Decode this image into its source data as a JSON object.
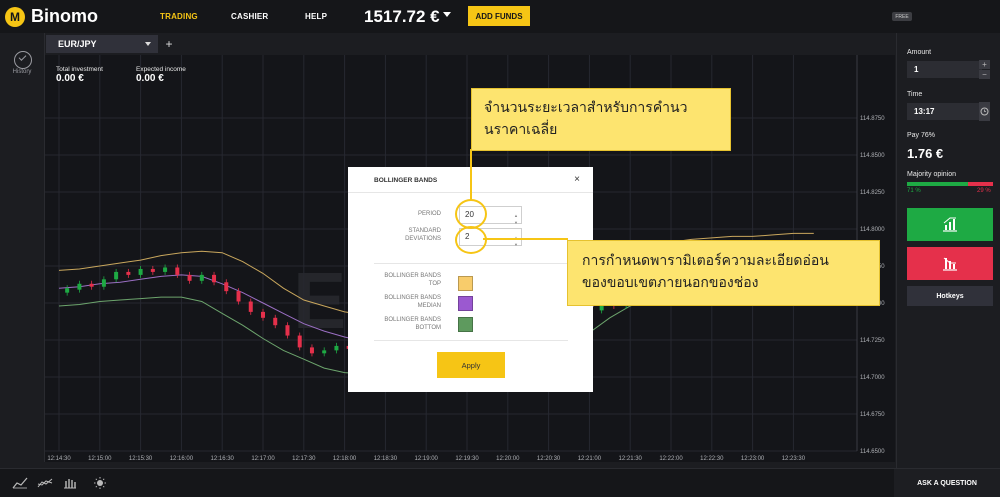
{
  "header": {
    "logo_text": "Binomo",
    "logo_mark": "M",
    "nav": [
      "TRADING",
      "CASHIER",
      "HELP"
    ],
    "balance": "1517.72 €",
    "add_funds_label": "ADD FUNDS",
    "free_badge": "FREE"
  },
  "left_sidebar": {
    "history_label": "History"
  },
  "asset": {
    "name": "EUR/JPY",
    "add_label": "+"
  },
  "stats": {
    "total_investment_label": "Total investment",
    "total_investment_value": "0.00 €",
    "expected_income_label": "Expected income",
    "expected_income_value": "0.00 €"
  },
  "chart_data": {
    "type": "line",
    "title": "",
    "y_ticks": [
      "114.8750",
      "114.8500",
      "114.8250",
      "114.8000",
      "114.7750",
      "114.7500",
      "114.7250",
      "114.7000",
      "114.6750",
      "114.6500"
    ],
    "x_ticks": [
      "12:14:30",
      "12:15:00",
      "12:15:30",
      "12:16:00",
      "12:16:30",
      "12:17:00",
      "12:17:30",
      "12:18:00",
      "12:18:30",
      "12:19:00",
      "12:19:30",
      "12:20:00",
      "12:20:30",
      "12:21:00",
      "12:21:30",
      "12:22:00",
      "12:22:30",
      "12:23:00",
      "12:23:30"
    ],
    "watermark": "EUR",
    "series": [
      {
        "color": "#c9a75d",
        "x": [
          0,
          0.5,
          1,
          1.5,
          2,
          2.5,
          3,
          3.5,
          4,
          4.5,
          5,
          5.5,
          6,
          6.5,
          7,
          7.5,
          8,
          9,
          10,
          11,
          12,
          13,
          13.5,
          14,
          14.5,
          15,
          15.5,
          16,
          16.5,
          17,
          17.5,
          18,
          18.5
        ],
        "values": [
          114.772,
          114.773,
          114.775,
          114.777,
          114.779,
          114.782,
          114.784,
          114.785,
          114.784,
          114.778,
          114.77,
          114.76,
          114.752,
          114.748,
          114.744,
          114.742,
          114.742,
          114.742,
          114.742,
          114.742,
          114.75,
          114.764,
          114.776,
          114.785,
          114.79,
          114.791,
          114.793,
          114.794,
          114.795,
          114.795,
          114.796,
          114.797,
          114.797
        ]
      },
      {
        "color": "#9b6fc4",
        "x": [
          0,
          0.5,
          1,
          1.5,
          2,
          2.5,
          3,
          3.5,
          4,
          4.5,
          5,
          5.5,
          6,
          6.5,
          7,
          7.5,
          8,
          13,
          13.5,
          14,
          14.5,
          15,
          15.5,
          16,
          16.5,
          17,
          17.5,
          18,
          18.5
        ],
        "values": [
          114.76,
          114.761,
          114.763,
          114.764,
          114.766,
          114.768,
          114.769,
          114.768,
          114.763,
          114.757,
          114.75,
          114.743,
          114.736,
          114.731,
          114.727,
          114.724,
          114.722,
          114.746,
          114.756,
          114.764,
          114.77,
          114.774,
          114.777,
          114.779,
          114.781,
          114.782,
          114.783,
          114.784,
          114.784
        ]
      },
      {
        "color": "#6da56d",
        "x": [
          0,
          0.5,
          1,
          1.5,
          2,
          2.5,
          3,
          3.5,
          4,
          4.5,
          5,
          5.5,
          6,
          6.5,
          7,
          7.5,
          8,
          13,
          13.5,
          14,
          14.5,
          15,
          15.5,
          16,
          16.5,
          17,
          17.5,
          18,
          18.5
        ],
        "values": [
          114.748,
          114.749,
          114.751,
          114.752,
          114.753,
          114.754,
          114.754,
          114.751,
          114.743,
          114.735,
          114.726,
          114.718,
          114.712,
          114.706,
          114.703,
          114.702,
          114.702,
          114.73,
          114.74,
          114.748,
          114.753,
          114.758,
          114.761,
          114.764,
          114.766,
          114.768,
          114.77,
          114.77,
          114.771
        ]
      }
    ],
    "candles": [
      {
        "x": 0.2,
        "o": 114.757,
        "c": 114.76,
        "dir": "up"
      },
      {
        "x": 0.5,
        "o": 114.759,
        "c": 114.763,
        "dir": "up"
      },
      {
        "x": 0.8,
        "o": 114.763,
        "c": 114.761,
        "dir": "down"
      },
      {
        "x": 1.1,
        "o": 114.761,
        "c": 114.766,
        "dir": "up"
      },
      {
        "x": 1.4,
        "o": 114.766,
        "c": 114.771,
        "dir": "up"
      },
      {
        "x": 1.7,
        "o": 114.771,
        "c": 114.769,
        "dir": "down"
      },
      {
        "x": 2.0,
        "o": 114.769,
        "c": 114.773,
        "dir": "up"
      },
      {
        "x": 2.3,
        "o": 114.773,
        "c": 114.771,
        "dir": "down"
      },
      {
        "x": 2.6,
        "o": 114.771,
        "c": 114.774,
        "dir": "up"
      },
      {
        "x": 2.9,
        "o": 114.774,
        "c": 114.769,
        "dir": "down"
      },
      {
        "x": 3.2,
        "o": 114.769,
        "c": 114.765,
        "dir": "down"
      },
      {
        "x": 3.5,
        "o": 114.765,
        "c": 114.769,
        "dir": "up"
      },
      {
        "x": 3.8,
        "o": 114.769,
        "c": 114.764,
        "dir": "down"
      },
      {
        "x": 4.1,
        "o": 114.764,
        "c": 114.758,
        "dir": "down"
      },
      {
        "x": 4.4,
        "o": 114.758,
        "c": 114.751,
        "dir": "down"
      },
      {
        "x": 4.7,
        "o": 114.751,
        "c": 114.744,
        "dir": "down"
      },
      {
        "x": 5.0,
        "o": 114.744,
        "c": 114.74,
        "dir": "down"
      },
      {
        "x": 5.3,
        "o": 114.74,
        "c": 114.735,
        "dir": "down"
      },
      {
        "x": 5.6,
        "o": 114.735,
        "c": 114.728,
        "dir": "down"
      },
      {
        "x": 5.9,
        "o": 114.728,
        "c": 114.72,
        "dir": "down"
      },
      {
        "x": 6.2,
        "o": 114.72,
        "c": 114.716,
        "dir": "down"
      },
      {
        "x": 6.5,
        "o": 114.716,
        "c": 114.718,
        "dir": "up"
      },
      {
        "x": 6.8,
        "o": 114.718,
        "c": 114.721,
        "dir": "up"
      },
      {
        "x": 7.1,
        "o": 114.721,
        "c": 114.719,
        "dir": "down"
      },
      {
        "x": 7.4,
        "o": 114.719,
        "c": 114.722,
        "dir": "up"
      },
      {
        "x": 7.7,
        "o": 114.722,
        "c": 114.72,
        "dir": "down"
      },
      {
        "x": 8.0,
        "o": 114.72,
        "c": 114.708,
        "dir": "down"
      },
      {
        "x": 8.3,
        "o": 114.708,
        "c": 114.7,
        "dir": "down"
      },
      {
        "x": 13.0,
        "o": 114.735,
        "c": 114.745,
        "dir": "up"
      },
      {
        "x": 13.3,
        "o": 114.745,
        "c": 114.753,
        "dir": "up"
      },
      {
        "x": 13.6,
        "o": 114.753,
        "c": 114.748,
        "dir": "down"
      },
      {
        "x": 13.9,
        "o": 114.748,
        "c": 114.756,
        "dir": "up"
      }
    ]
  },
  "modal": {
    "title": "BOLLINGER BANDS",
    "close": "×",
    "period_label": "PERIOD",
    "period_value": "20",
    "std_label_1": "STANDARD",
    "std_label_2": "DEVIATIONS",
    "std_value": "2",
    "top_label_1": "BOLLINGER BANDS",
    "top_label_2": "TOP",
    "median_label_1": "BOLLINGER BANDS",
    "median_label_2": "MEDIAN",
    "bottom_label_1": "BOLLINGER BANDS",
    "bottom_label_2": "BOTTOM",
    "top_color": "#f8cc6b",
    "median_color": "#9b59d0",
    "bottom_color": "#5e9a5e",
    "apply_label": "Apply"
  },
  "callouts": {
    "period_line_1": "จำนวนระยะเวลาสำหรับการคำนว",
    "period_line_2": "นราคาเฉลี่ย",
    "std_line_1": "การกำหนดพารามิเตอร์ความละเอียดอ่อน",
    "std_line_2": "ของขอบเขตภายนอกของช่อง"
  },
  "right_panel": {
    "amount_label": "Amount",
    "amount_value": "1",
    "time_label": "Time",
    "time_value": "13:17",
    "pay_label": "Pay 76%",
    "pay_value": "1.76 €",
    "majority_label": "Majority opinion",
    "majority_up": "71 %",
    "majority_down": "29 %",
    "majority_up_fraction": 0.71,
    "hotkeys_label": "Hotkeys"
  },
  "bottom": {
    "ask_label": "ASK A QUESTION"
  },
  "colors": {
    "accent": "#f6c515",
    "up": "#1eaa44",
    "down": "#e5304b"
  }
}
